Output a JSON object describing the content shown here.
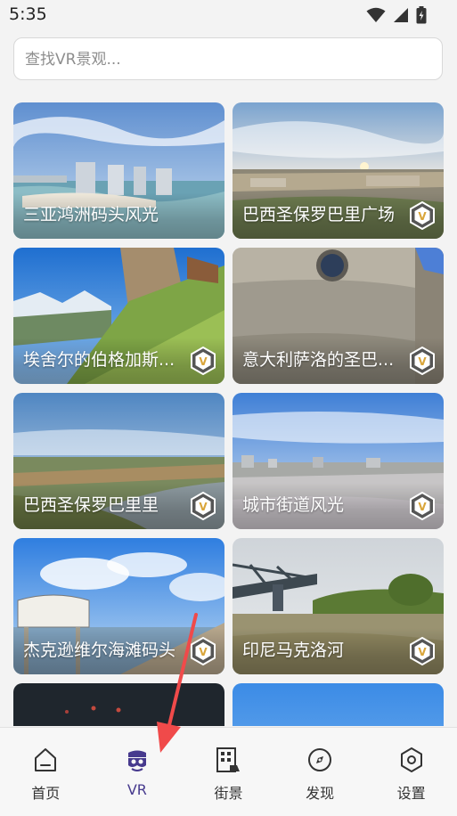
{
  "status": {
    "time": "5:35"
  },
  "search": {
    "placeholder": "查找VR景观..."
  },
  "cards": [
    {
      "title": "三亚鸿洲码头风光"
    },
    {
      "title": "巴西圣保罗巴里广场"
    },
    {
      "title": "埃舍尔的伯格加斯..."
    },
    {
      "title": "意大利萨洛的圣巴..."
    },
    {
      "title": "巴西圣保罗巴里里"
    },
    {
      "title": "城市街道风光"
    },
    {
      "title": "杰克逊维尔海滩码头"
    },
    {
      "title": "印尼马克洛河"
    }
  ],
  "badge": {
    "letter": "V"
  },
  "nav": {
    "items": [
      {
        "label": "首页",
        "icon": "home-icon"
      },
      {
        "label": "VR",
        "icon": "vr-headset-icon"
      },
      {
        "label": "街景",
        "icon": "street-view-icon"
      },
      {
        "label": "发现",
        "icon": "compass-icon"
      },
      {
        "label": "设置",
        "icon": "settings-icon"
      }
    ],
    "active_index": 1
  },
  "colors": {
    "accent": "#473a8e",
    "badge_bg": "#555555",
    "badge_ring": "#ffffff",
    "badge_letter": "#d9a53a",
    "arrow": "#f04a4a"
  }
}
